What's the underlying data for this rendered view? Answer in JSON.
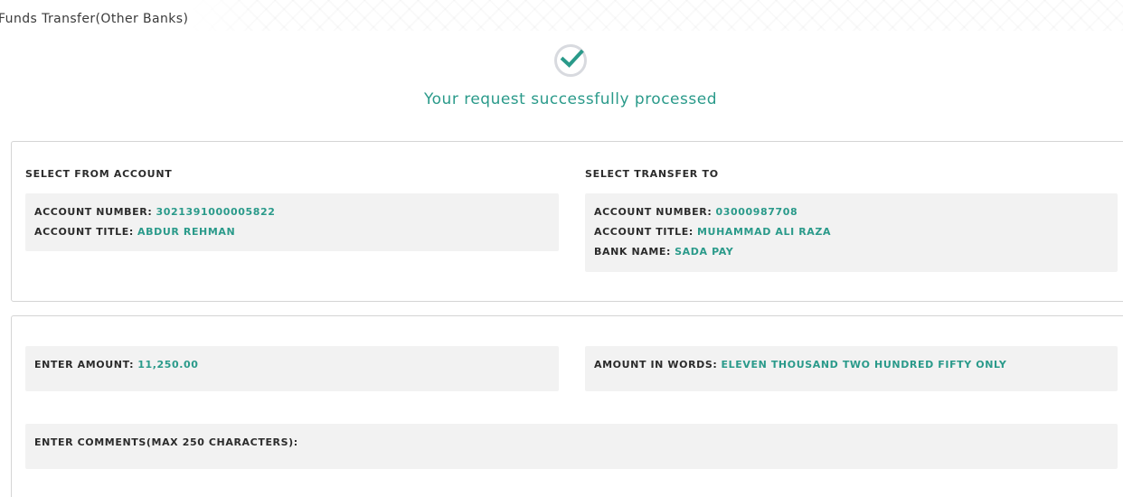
{
  "page": {
    "title": "Funds Transfer(Other Banks)",
    "success_message": "Your request successfully processed"
  },
  "from_account": {
    "section_label": "SELECT FROM ACCOUNT",
    "account_number_label": "ACCOUNT NUMBER:",
    "account_number": "3021391000005822",
    "account_title_label": "ACCOUNT TITLE:",
    "account_title": "ABDUR REHMAN"
  },
  "transfer_to": {
    "section_label": "SELECT TRANSFER TO",
    "account_number_label": "ACCOUNT NUMBER:",
    "account_number": "03000987708",
    "account_title_label": "ACCOUNT TITLE:",
    "account_title": "MUHAMMAD ALI RAZA",
    "bank_name_label": "BANK NAME:",
    "bank_name": "SADA PAY"
  },
  "amount": {
    "label": "ENTER AMOUNT:",
    "value": "11,250.00",
    "words_label": "AMOUNT IN WORDS:",
    "words_value": "ELEVEN THOUSAND TWO HUNDRED FIFTY ONLY"
  },
  "comments": {
    "label": "ENTER COMMENTS(MAX 250 CHARACTERS):",
    "value": ""
  },
  "colors": {
    "accent": "#2a9a8a",
    "box_background": "#f2f2f2",
    "border": "#d4d4d4",
    "icon_ring": "#d8dadf"
  },
  "icons": {
    "success": "check-circle-icon"
  }
}
